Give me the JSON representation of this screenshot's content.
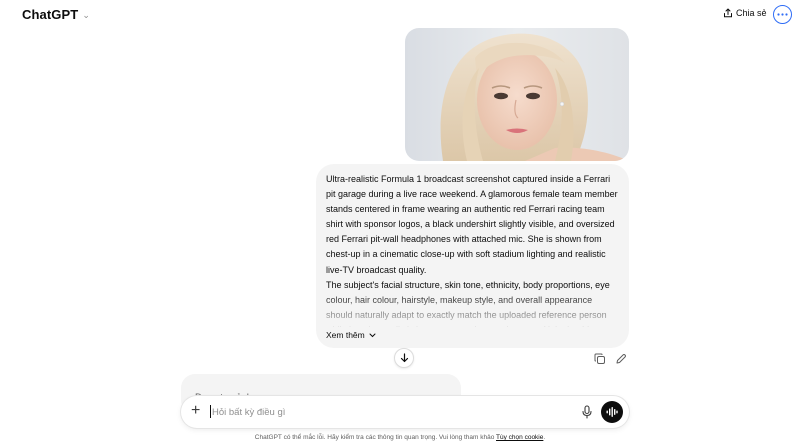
{
  "header": {
    "model_name": "ChatGPT",
    "share_label": "Chia sẻ",
    "share_icon": "share-icon",
    "more_icon": "ellipsis-icon"
  },
  "message": {
    "attachment_icon": "portrait-photo",
    "prompt_text": "Ultra-realistic Formula 1 broadcast screenshot captured inside a Ferrari pit garage during a live race weekend. A glamorous female team member stands centered in frame wearing an authentic red Ferrari racing team shirt with sponsor logos, a black undershirt slightly visible, and oversized red Ferrari pit-wall headphones with attached mic. She is shown from chest-up in a cinematic close-up with soft stadium lighting and realistic live-TV broadcast quality.\nThe subject's facial structure, skin tone, ethnicity, body proportions, eye colour, hair colour, hairstyle, makeup style, and overall appearance should naturally adapt to exactly match the uploaded reference person while keeping realistic human proportions and texture. Hair should",
    "see_more_label": "Xem thêm",
    "copy_icon": "copy-icon",
    "edit_icon": "pencil-icon"
  },
  "response": {
    "status_text": "Đang tạo ảnh"
  },
  "composer": {
    "placeholder": "Hỏi bất kỳ điều gì",
    "plus_icon": "plus-icon",
    "mic_icon": "mic-icon",
    "voice_icon": "voice-mode-icon"
  },
  "footer": {
    "disclaimer_text": "ChatGPT có thể mắc lỗi. Hãy kiểm tra các thông tin quan trọng. Vui lòng tham khảo ",
    "cookie_link": "Tùy chọn cookie",
    "period": "."
  },
  "colors": {
    "bubble_bg": "#f4f4f4",
    "accent_blue": "#2f6df6",
    "voice_btn": "#0d0d0d"
  }
}
